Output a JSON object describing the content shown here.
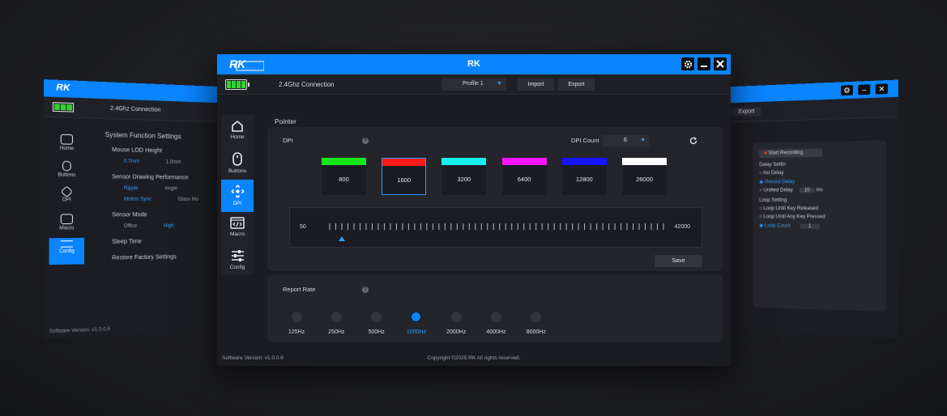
{
  "app": {
    "title": "RK",
    "logo_text": "RK",
    "connection": "2.4Ghz Connection",
    "profile": "Profile 1",
    "import_label": "Import",
    "export_label": "Export",
    "battery_level": 1.0,
    "accent": "#0a84ff"
  },
  "nav": [
    {
      "label": "Home",
      "icon": "home-icon"
    },
    {
      "label": "Buttons",
      "icon": "mouse-icon"
    },
    {
      "label": "DPI",
      "icon": "dpi-icon",
      "active": true
    },
    {
      "label": "Macro",
      "icon": "code-icon"
    },
    {
      "label": "Config",
      "icon": "sliders-icon"
    }
  ],
  "pointer": {
    "section_title": "Pointer",
    "dpi_label": "DPI",
    "dpi_count_label": "DPI Count",
    "dpi_count_value": "6",
    "stages": [
      {
        "value": "800",
        "color": "#19e619"
      },
      {
        "value": "1600",
        "color": "#ff1a1a",
        "selected": true
      },
      {
        "value": "3200",
        "color": "#14f0f0"
      },
      {
        "value": "6400",
        "color": "#ff14ff"
      },
      {
        "value": "12800",
        "color": "#1414ff"
      },
      {
        "value": "26000",
        "color": "#ffffff"
      }
    ],
    "slider_min": "50",
    "slider_max": "42000",
    "slider_value": 1600,
    "save_label": "Save"
  },
  "report_rate": {
    "label": "Report Rate",
    "options": [
      "125Hz",
      "250Hz",
      "500Hz",
      "1000Hz",
      "2000Hz",
      "4000Hz",
      "8000Hz"
    ],
    "selected": "1000Hz"
  },
  "footer": {
    "version": "Software Version: v1.0.0.6",
    "copyright": "Copyright ©2025 RK All rights reserved."
  },
  "left_window": {
    "connection": "2.4Ghz Connection",
    "nav": [
      "Home",
      "Buttons",
      "DPI",
      "Macro",
      "Config"
    ],
    "heading": "System Function Settings",
    "groups": [
      {
        "title": "Mouse LOD Height",
        "options": [
          "0.7mm",
          "1.0mm"
        ]
      },
      {
        "title": "Sensor Drawing Performance",
        "options": [
          "Ripple",
          "Angle",
          "Motion Sync",
          "Glass Mo"
        ]
      },
      {
        "title": "Sensor Mode",
        "options": [
          "Office",
          "High"
        ]
      },
      {
        "title": "Sleep Time",
        "options": []
      },
      {
        "title": "Restore Factory Settings",
        "options": []
      }
    ],
    "version": "Software Version: v1.0.0.6"
  },
  "right_window": {
    "export_label": "Export",
    "start_recording": "Start Recording",
    "delay_heading": "Delay Settin",
    "delay_options": [
      "No Delay",
      "Record Delay",
      "Unified Delay"
    ],
    "delay_value": "10",
    "delay_unit": "ms",
    "loop_heading": "Loop Setting",
    "loop_options": [
      "Loop Until Key Released",
      "Loop Until Any Key Pressed",
      "Loop Count"
    ],
    "loop_count": "1"
  }
}
